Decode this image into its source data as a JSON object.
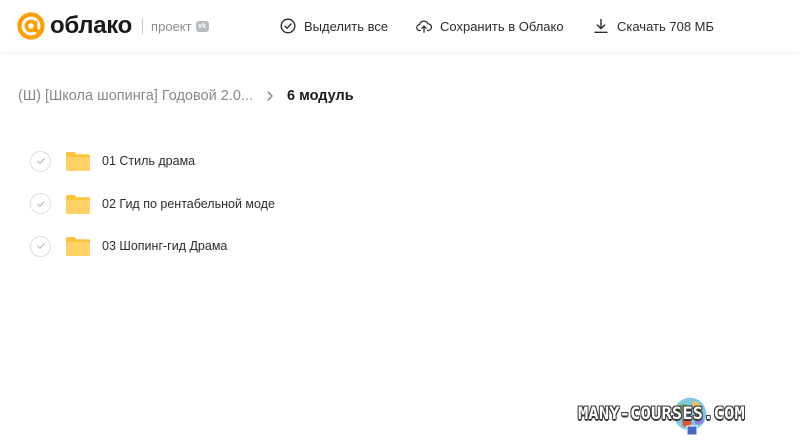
{
  "header": {
    "logo_text": "облако",
    "project_label": "проект",
    "vk_badge": "vk",
    "actions": [
      {
        "label": "Выделить все",
        "icon": "check-circle-icon"
      },
      {
        "label": "Сохранить в Облако",
        "icon": "cloud-upload-icon"
      },
      {
        "label": "Скачать 708 МБ",
        "icon": "download-icon"
      }
    ]
  },
  "breadcrumb": {
    "parent": "(Ш) [Школа шопинга] Годовой 2.0...",
    "current": "6 модуль"
  },
  "files": [
    {
      "name": "01 Стиль драма",
      "type": "folder"
    },
    {
      "name": "02 Гид по рентабельной моде",
      "type": "folder"
    },
    {
      "name": "03 Шопинг-гид Драма",
      "type": "folder"
    }
  ],
  "watermark": {
    "text": "MANY-COURSES.COM"
  },
  "colors": {
    "brand_orange": "#ff9e00",
    "folder_yellow": "#ffc43d",
    "text_primary": "#2c2d2e",
    "text_secondary": "#87898f"
  }
}
